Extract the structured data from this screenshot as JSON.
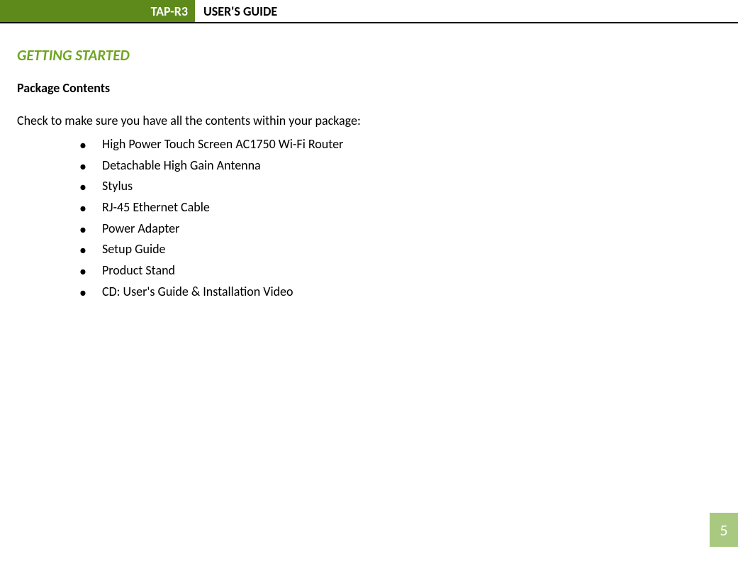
{
  "header": {
    "product_code": "TAP-R3",
    "title": "USER'S GUIDE"
  },
  "section": {
    "heading": "GETTING STARTED",
    "sub_heading": "Package Contents",
    "intro": "Check to make sure you have all the contents within your package:",
    "items": [
      "High Power Touch Screen AC1750 Wi-Fi Router",
      "Detachable High Gain Antenna",
      "Stylus",
      "RJ-45 Ethernet Cable",
      "Power Adapter",
      "Setup Guide",
      "Product Stand",
      "CD: User's Guide & Installation Video"
    ]
  },
  "page_number": "5"
}
